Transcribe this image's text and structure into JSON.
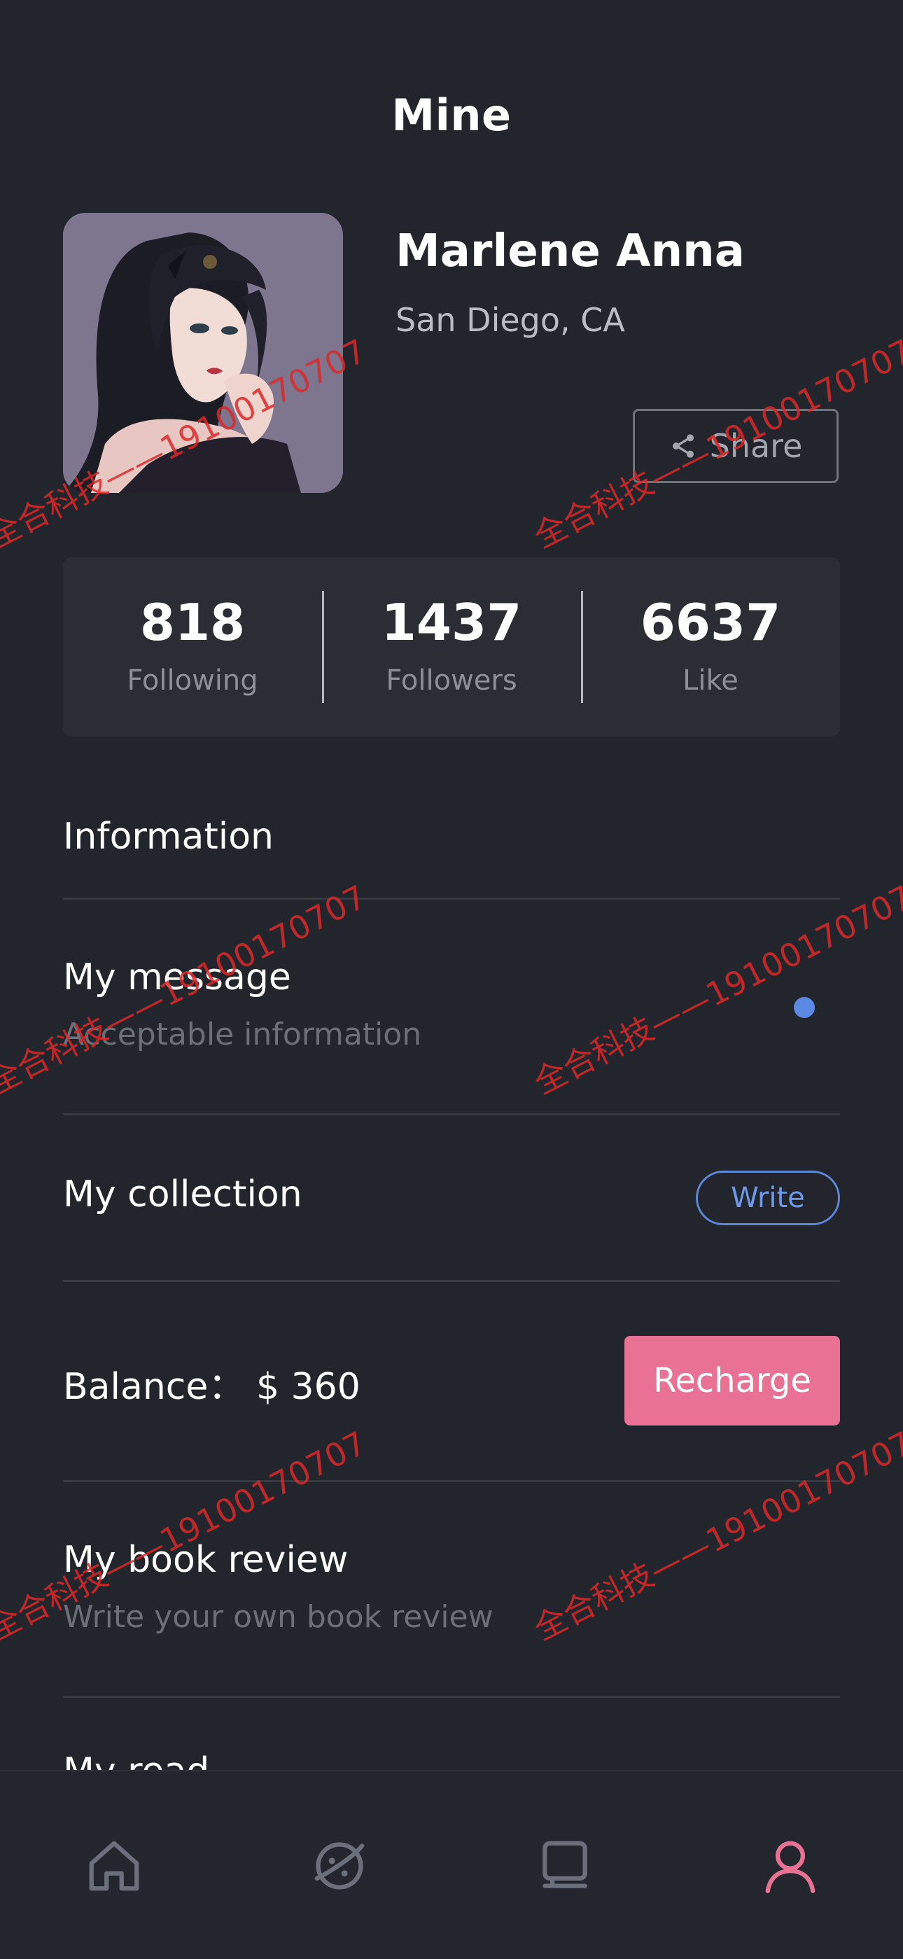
{
  "header": {
    "title": "Mine"
  },
  "profile": {
    "name": "Marlene Anna",
    "location": "San Diego, CA",
    "share_label": "Share"
  },
  "stats": [
    {
      "value": "818",
      "label": "Following"
    },
    {
      "value": "1437",
      "label": "Followers"
    },
    {
      "value": "6637",
      "label": "Like"
    }
  ],
  "information": {
    "title": "Information",
    "message": {
      "title": "My message",
      "subtitle": "Acceptable information"
    },
    "collection": {
      "title": "My collection",
      "button_label": "Write"
    },
    "balance": {
      "label": "Balance：",
      "amount": "$ 360",
      "button_label": "Recharge"
    },
    "book_review": {
      "title": "My book review",
      "subtitle": "Write your own book review"
    },
    "cutoff_row": {
      "title": "My read"
    }
  },
  "tabbar": {
    "tabs": [
      {
        "icon": "home-icon"
      },
      {
        "icon": "discover-planet-icon"
      },
      {
        "icon": "bookshelf-icon"
      },
      {
        "icon": "profile-icon",
        "active": true
      }
    ],
    "active_color": "#e97294",
    "inactive_color": "#6a6f7c"
  },
  "watermark": {
    "text": "全合科技——19100170707"
  },
  "colors": {
    "background": "#22252c",
    "accent_blue": "#5b88e0",
    "accent_pink": "#e97294"
  }
}
